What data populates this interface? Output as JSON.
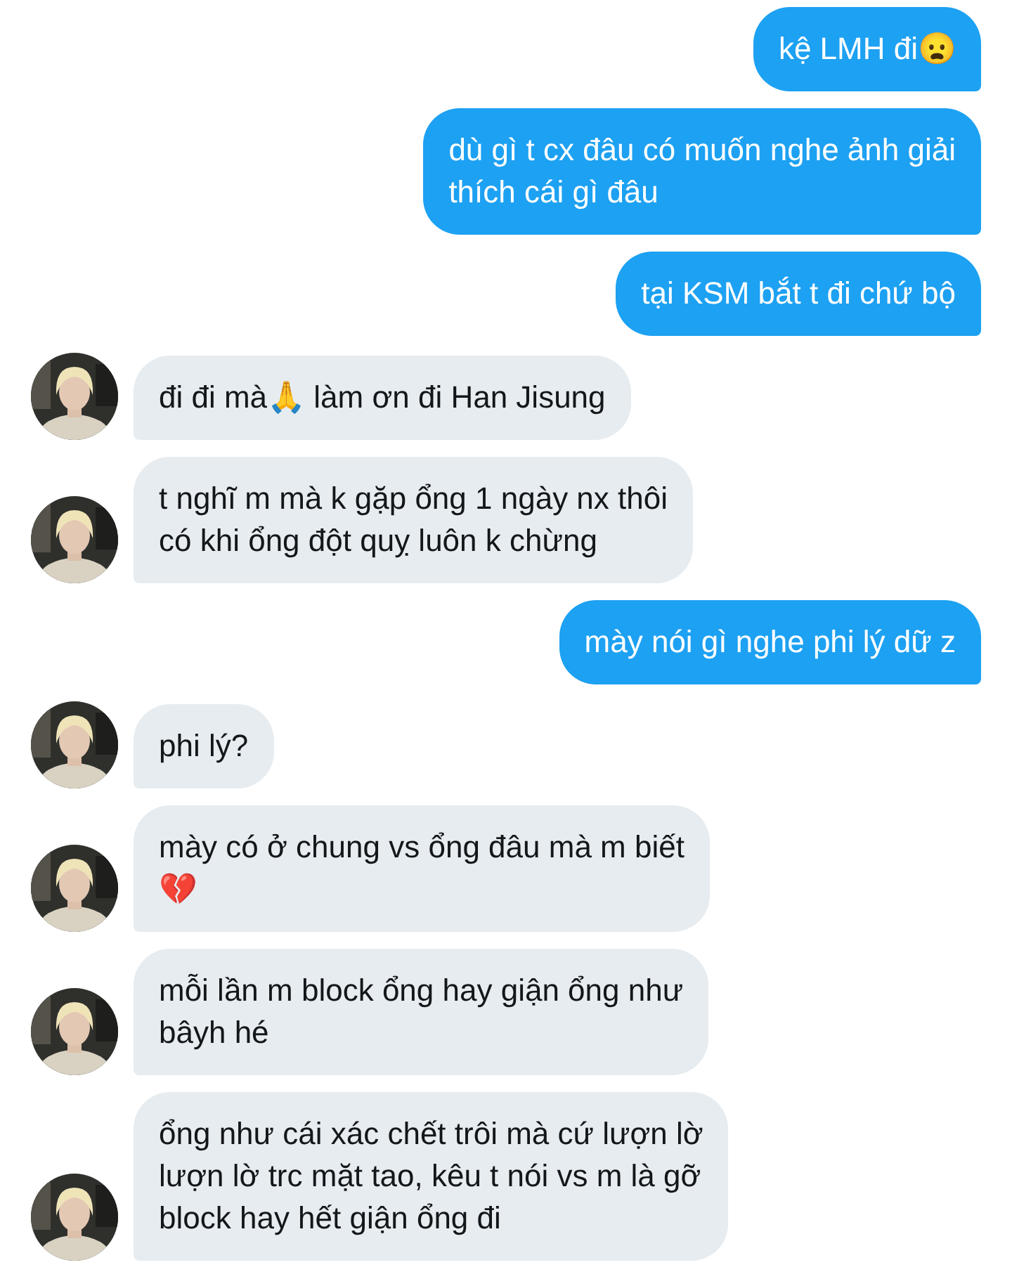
{
  "messages": [
    {
      "kind": "sent",
      "text": "kệ LMH đi😦"
    },
    {
      "kind": "sent",
      "text": "dù gì t cx đâu có muốn nghe ảnh giải\nthích cái gì đâu"
    },
    {
      "kind": "sent",
      "text": "tại KSM bắt t đi chứ bộ"
    },
    {
      "kind": "received",
      "text": "đi đi mà🙏 làm ơn đi Han Jisung"
    },
    {
      "kind": "received",
      "text": "t nghĩ m mà k gặp ổng 1 ngày nx thôi\ncó khi ổng đột quỵ luôn k chừng"
    },
    {
      "kind": "sent",
      "text": "mày nói gì nghe phi lý dữ z"
    },
    {
      "kind": "received",
      "text": "phi lý?"
    },
    {
      "kind": "received",
      "text": "mày có ở chung vs ổng đâu mà m biết\n💔"
    },
    {
      "kind": "received",
      "text": "mỗi lần m block ổng hay giận ổng như\nbâyh hé"
    },
    {
      "kind": "received",
      "text": "ổng như cái xác chết trôi mà cứ lượn lờ\nlượn lờ trc mặt tao, kêu t nói vs m là gỡ\nblock hay hết giận ổng đi"
    }
  ]
}
